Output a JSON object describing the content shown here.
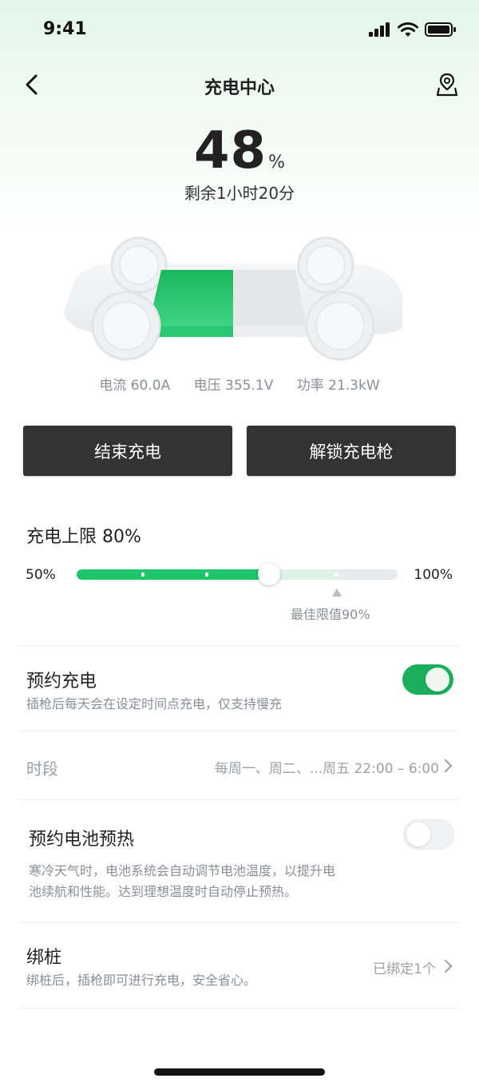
{
  "status_bar": {
    "time": "9:41"
  },
  "header": {
    "title": "充电中心"
  },
  "battery": {
    "percent": "48",
    "unit": "%",
    "remaining": "剩余1小时20分",
    "level": 0.48
  },
  "metrics": {
    "current": "电流 60.0A",
    "voltage": "电压 355.1V",
    "power": "功率 21.3kW"
  },
  "actions": {
    "stop_label": "结束充电",
    "unlock_label": "解锁充电枪"
  },
  "charge_limit": {
    "title": "充电上限 80%",
    "min_label": "50%",
    "max_label": "100%",
    "value_percent": 80,
    "best_label": "最佳限值90%"
  },
  "scheduled_charging": {
    "title": "预约充电",
    "desc": "插枪后每天会在设定时间点充电，仅支持慢充",
    "enabled": true,
    "period_label": "时段",
    "period_value": "每周一、周二、...周五 22:00 – 6:00"
  },
  "preheat": {
    "title": "预约电池预热",
    "desc_line1": "寒冷天气时，电池系统会自动调节电池温度，以提升电",
    "desc_line2": "池续航和性能。达到理想温度时自动停止预热。",
    "enabled": false
  },
  "binding": {
    "title": "绑桩",
    "desc": "绑桩后，插枪即可进行充电，安全省心。",
    "status": "已绑定1个"
  },
  "colors": {
    "accent": "#1ec56b",
    "button_bg": "#333333",
    "toggle_on": "#1aae5d"
  },
  "icons": [
    "back-arrow-icon",
    "map-pin-icon",
    "signal-icon",
    "wifi-icon",
    "battery-icon",
    "chevron-right-icon"
  ]
}
